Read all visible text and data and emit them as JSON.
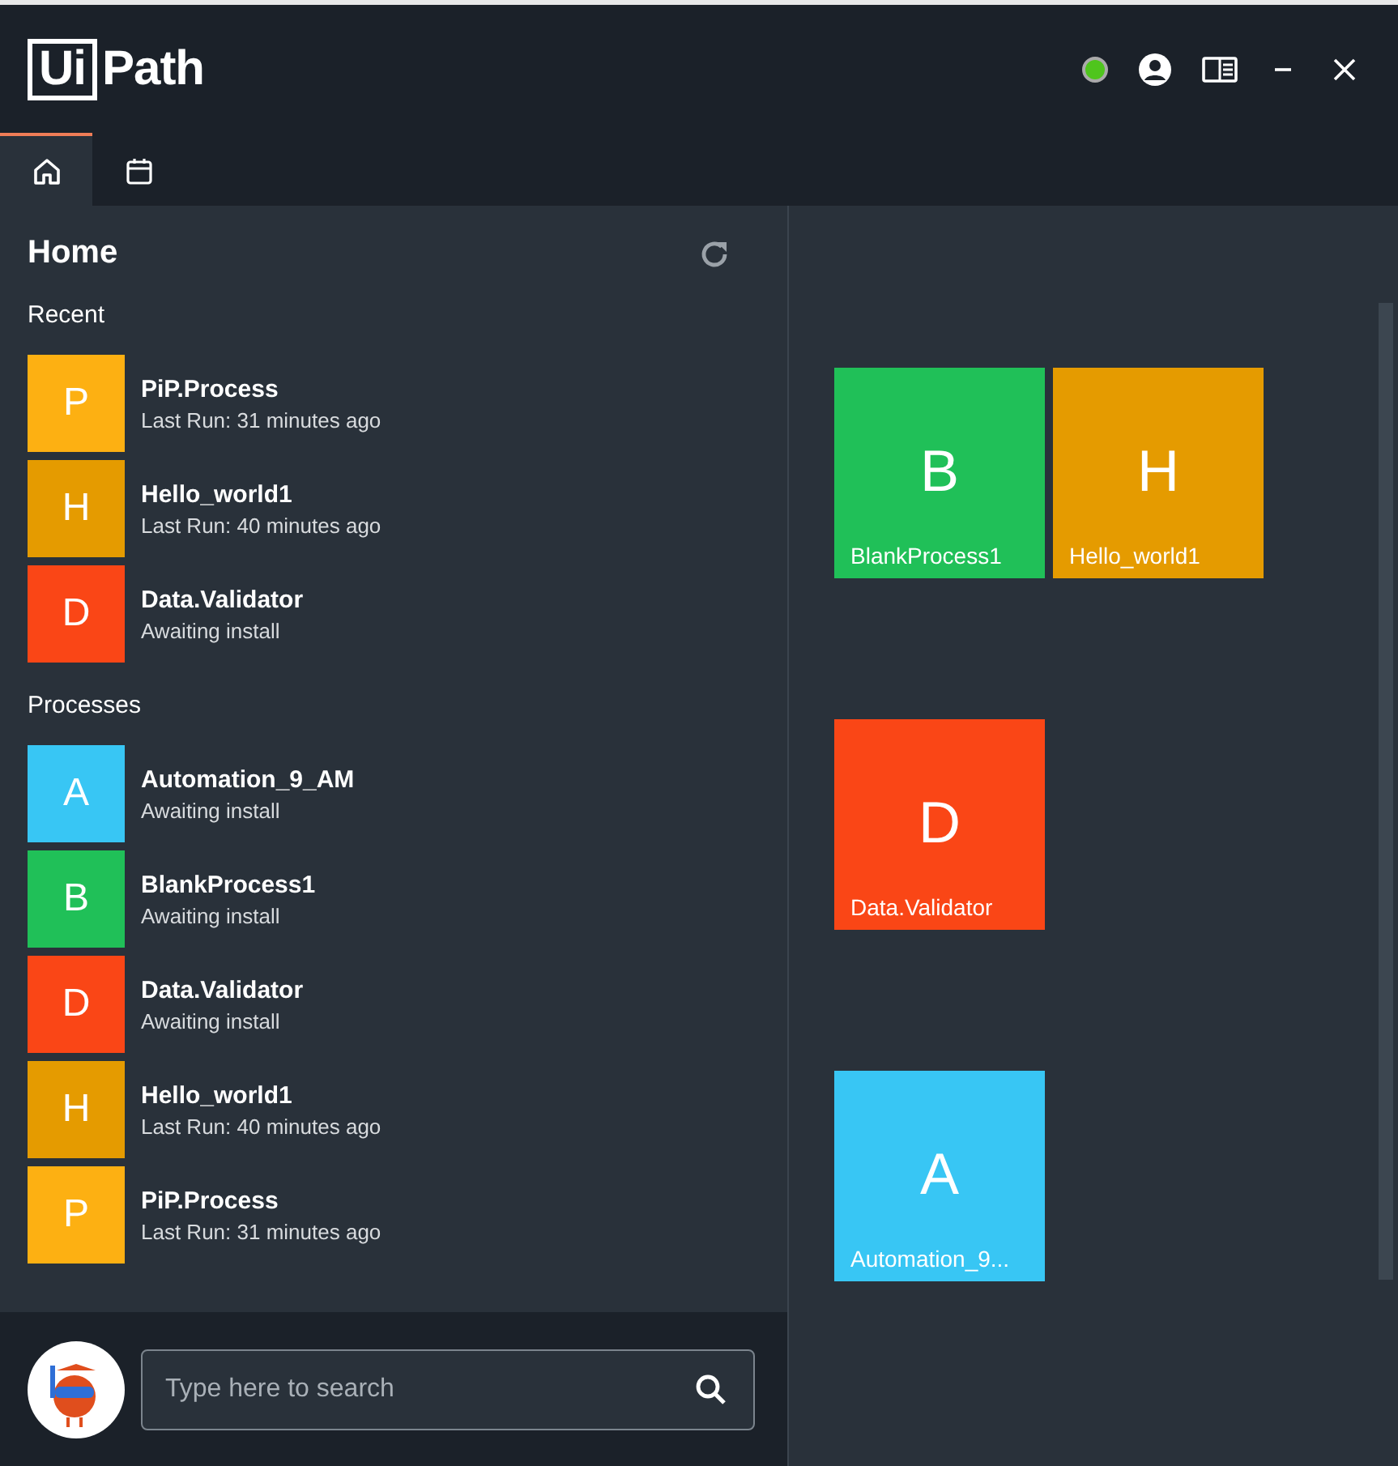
{
  "header": {
    "logo_box": "Ui",
    "logo_text": "Path",
    "connected": true
  },
  "tabs": [
    {
      "kind": "home",
      "selected": true
    },
    {
      "kind": "calendar",
      "selected": false
    }
  ],
  "home": {
    "title": "Home",
    "sections": [
      {
        "label": "Recent",
        "items": [
          {
            "letter": "P",
            "name": "PiP.Process",
            "status": "Last Run: 31 minutes ago",
            "color": "#fdb012"
          },
          {
            "letter": "H",
            "name": "Hello_world1",
            "status": "Last Run: 40 minutes ago",
            "color": "#e59b00"
          },
          {
            "letter": "D",
            "name": "Data.Validator",
            "status": "Awaiting install",
            "color": "#fa4616"
          }
        ]
      },
      {
        "label": "Processes",
        "items": [
          {
            "letter": "A",
            "name": "Automation_9_AM",
            "status": "Awaiting install",
            "color": "#38c6f4"
          },
          {
            "letter": "B",
            "name": "BlankProcess1",
            "status": "Awaiting install",
            "color": "#20c058"
          },
          {
            "letter": "D",
            "name": "Data.Validator",
            "status": "Awaiting install",
            "color": "#fa4616"
          },
          {
            "letter": "H",
            "name": "Hello_world1",
            "status": "Last Run: 40 minutes ago",
            "color": "#e59b00"
          },
          {
            "letter": "P",
            "name": "PiP.Process",
            "status": "Last Run: 31 minutes ago",
            "color": "#fdb012"
          }
        ]
      }
    ]
  },
  "search": {
    "placeholder": "Type here to search"
  },
  "tile_groups": [
    {
      "tiles": [
        {
          "letter": "B",
          "name": "BlankProcess1",
          "color": "#20c058"
        },
        {
          "letter": "H",
          "name": "Hello_world1",
          "color": "#e59b00"
        }
      ]
    },
    {
      "tiles": [
        {
          "letter": "D",
          "name": "Data.Validator",
          "color": "#fa4616"
        }
      ]
    },
    {
      "tiles": [
        {
          "letter": "A",
          "name": "Automation_9...",
          "color": "#38c6f4"
        }
      ]
    }
  ]
}
